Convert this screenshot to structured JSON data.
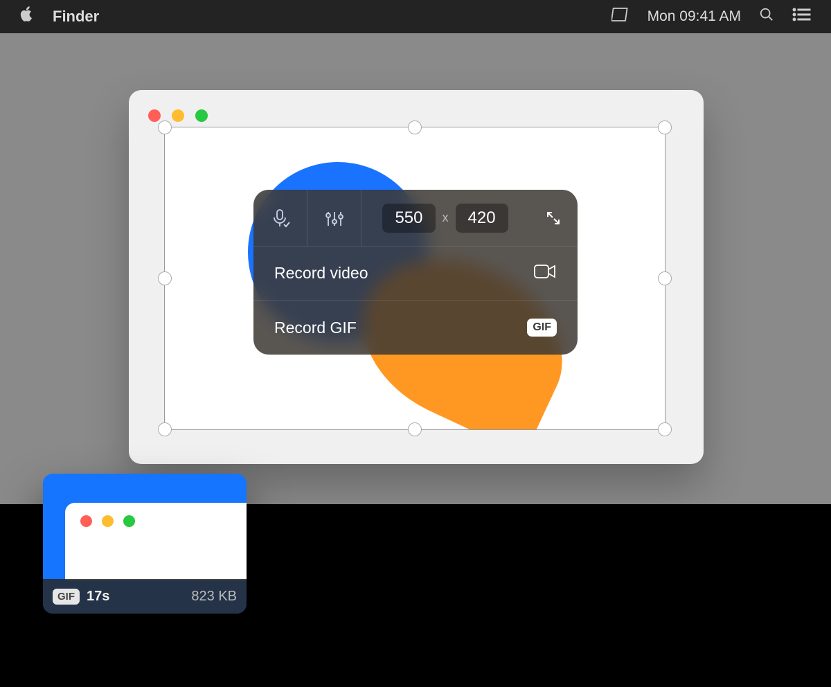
{
  "menubar": {
    "app_name": "Finder",
    "time": "Mon 09:41 AM"
  },
  "recorder": {
    "width": "550",
    "height": "420",
    "separator": "x",
    "row_video": "Record video",
    "row_gif": "Record GIF",
    "gif_badge": "GIF"
  },
  "thumbnail": {
    "badge": "GIF",
    "duration": "17s",
    "size": "823 KB"
  }
}
